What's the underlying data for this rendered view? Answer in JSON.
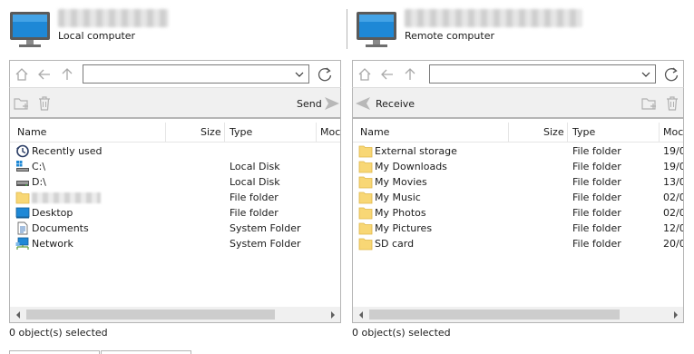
{
  "local": {
    "subtitle": "Local computer",
    "search": {
      "value": ""
    },
    "send_label": "Send",
    "columns": {
      "name": "Name",
      "size": "Size",
      "type": "Type",
      "modified": "Moc"
    },
    "rows": [
      {
        "name": "Recently used",
        "type": "",
        "icon": "recent-icon"
      },
      {
        "name": "C:\\",
        "type": "Local Disk",
        "icon": "drive-c-icon"
      },
      {
        "name": "D:\\",
        "type": "Local Disk",
        "icon": "drive-d-icon"
      },
      {
        "name": "",
        "type": "File folder",
        "icon": "folder-icon"
      },
      {
        "name": "Desktop",
        "type": "File folder",
        "icon": "desktop-icon"
      },
      {
        "name": "Documents",
        "type": "System Folder",
        "icon": "documents-icon"
      },
      {
        "name": "Network",
        "type": "System Folder",
        "icon": "network-icon"
      }
    ],
    "status": "0 object(s) selected"
  },
  "remote": {
    "subtitle": "Remote computer",
    "search": {
      "value": ""
    },
    "receive_label": "Receive",
    "columns": {
      "name": "Name",
      "size": "Size",
      "type": "Type",
      "modified": "Moc"
    },
    "rows": [
      {
        "name": "External storage",
        "type": "File folder",
        "modified": "19/0"
      },
      {
        "name": "My Downloads",
        "type": "File folder",
        "modified": "19/0"
      },
      {
        "name": "My Movies",
        "type": "File folder",
        "modified": "13/0"
      },
      {
        "name": "My Music",
        "type": "File folder",
        "modified": "02/0"
      },
      {
        "name": "My Photos",
        "type": "File folder",
        "modified": "02/0"
      },
      {
        "name": "My Pictures",
        "type": "File folder",
        "modified": "12/0"
      },
      {
        "name": "SD card",
        "type": "File folder",
        "modified": "20/0"
      }
    ],
    "status": "0 object(s) selected"
  },
  "colors": {
    "folder": "#f8d775",
    "monitor": "#1e88d6",
    "icon_gray": "#a8a8a8"
  }
}
